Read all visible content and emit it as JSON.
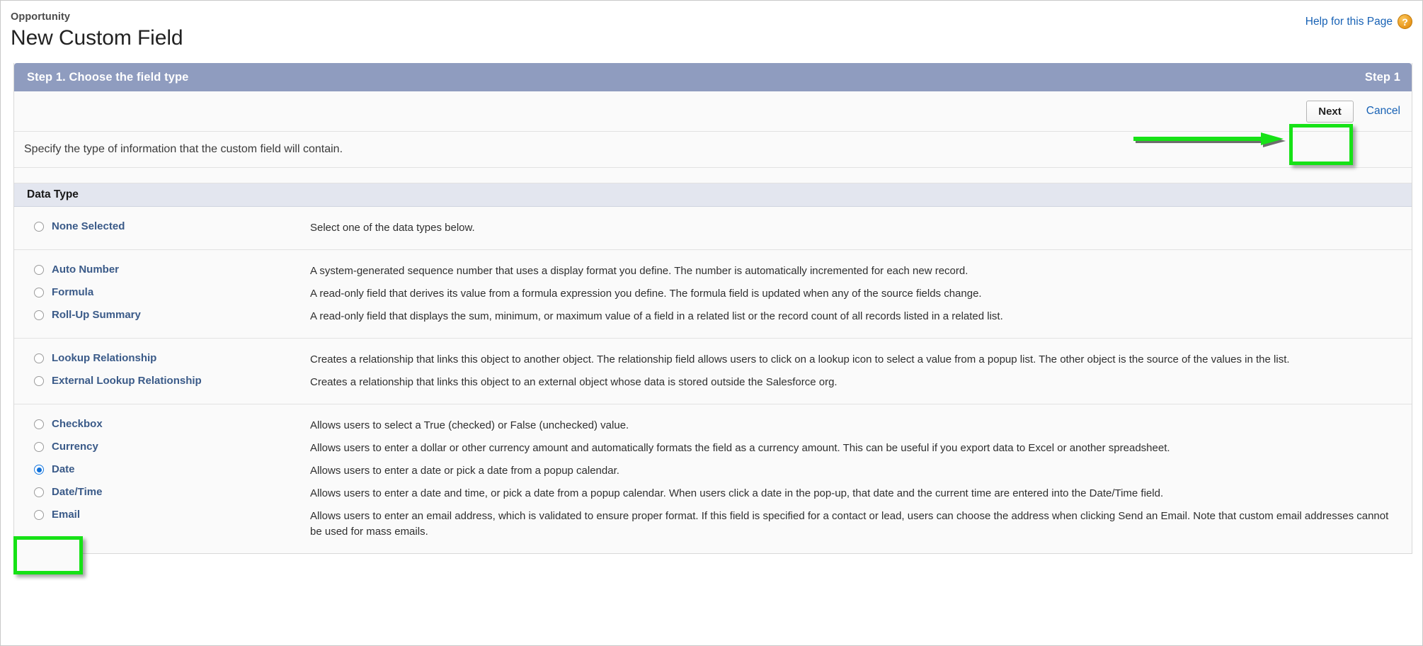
{
  "header": {
    "eyebrow": "Opportunity",
    "title": "New Custom Field",
    "help_link": "Help for this Page",
    "help_icon": "question-mark-icon",
    "help_icon_glyph": "?"
  },
  "step": {
    "title": "Step 1. Choose the field type",
    "indicator": "Step 1"
  },
  "actions": {
    "next_label": "Next",
    "cancel_label": "Cancel"
  },
  "instruction": "Specify the type of information that the custom field will contain.",
  "section": {
    "heading": "Data Type"
  },
  "colors": {
    "step_bar": "#8f9cbf",
    "section_head": "#e3e6ef",
    "link": "#1862b5",
    "radio_label": "#3a5a88",
    "annotation_green": "#16e216",
    "radio_selected": "#1070d8"
  },
  "annotations": {
    "arrow": "green-arrow-pointing-right",
    "next_highlight": "green-box-around-next-button",
    "date_highlight": "green-box-around-date-option"
  },
  "groups": [
    {
      "options": [
        {
          "label": "None Selected",
          "description": "Select one of the data types below.",
          "selected": false
        }
      ]
    },
    {
      "options": [
        {
          "label": "Auto Number",
          "description": "A system-generated sequence number that uses a display format you define. The number is automatically incremented for each new record.",
          "selected": false
        },
        {
          "label": "Formula",
          "description": "A read-only field that derives its value from a formula expression you define. The formula field is updated when any of the source fields change.",
          "selected": false
        },
        {
          "label": "Roll-Up Summary",
          "description": "A read-only field that displays the sum, minimum, or maximum value of a field in a related list or the record count of all records listed in a related list.",
          "selected": false
        }
      ]
    },
    {
      "options": [
        {
          "label": "Lookup Relationship",
          "description": "Creates a relationship that links this object to another object. The relationship field allows users to click on a lookup icon to select a value from a popup list. The other object is the source of the values in the list.",
          "selected": false
        },
        {
          "label": "External Lookup Relationship",
          "description": "Creates a relationship that links this object to an external object whose data is stored outside the Salesforce org.",
          "selected": false
        }
      ]
    },
    {
      "options": [
        {
          "label": "Checkbox",
          "description": "Allows users to select a True (checked) or False (unchecked) value.",
          "selected": false
        },
        {
          "label": "Currency",
          "description": "Allows users to enter a dollar or other currency amount and automatically formats the field as a currency amount. This can be useful if you export data to Excel or another spreadsheet.",
          "selected": false
        },
        {
          "label": "Date",
          "description": "Allows users to enter a date or pick a date from a popup calendar.",
          "selected": true
        },
        {
          "label": "Date/Time",
          "description": "Allows users to enter a date and time, or pick a date from a popup calendar. When users click a date in the pop-up, that date and the current time are entered into the Date/Time field.",
          "selected": false
        },
        {
          "label": "Email",
          "description": "Allows users to enter an email address, which is validated to ensure proper format. If this field is specified for a contact or lead, users can choose the address when clicking Send an Email. Note that custom email addresses cannot be used for mass emails.",
          "selected": false
        }
      ]
    }
  ]
}
